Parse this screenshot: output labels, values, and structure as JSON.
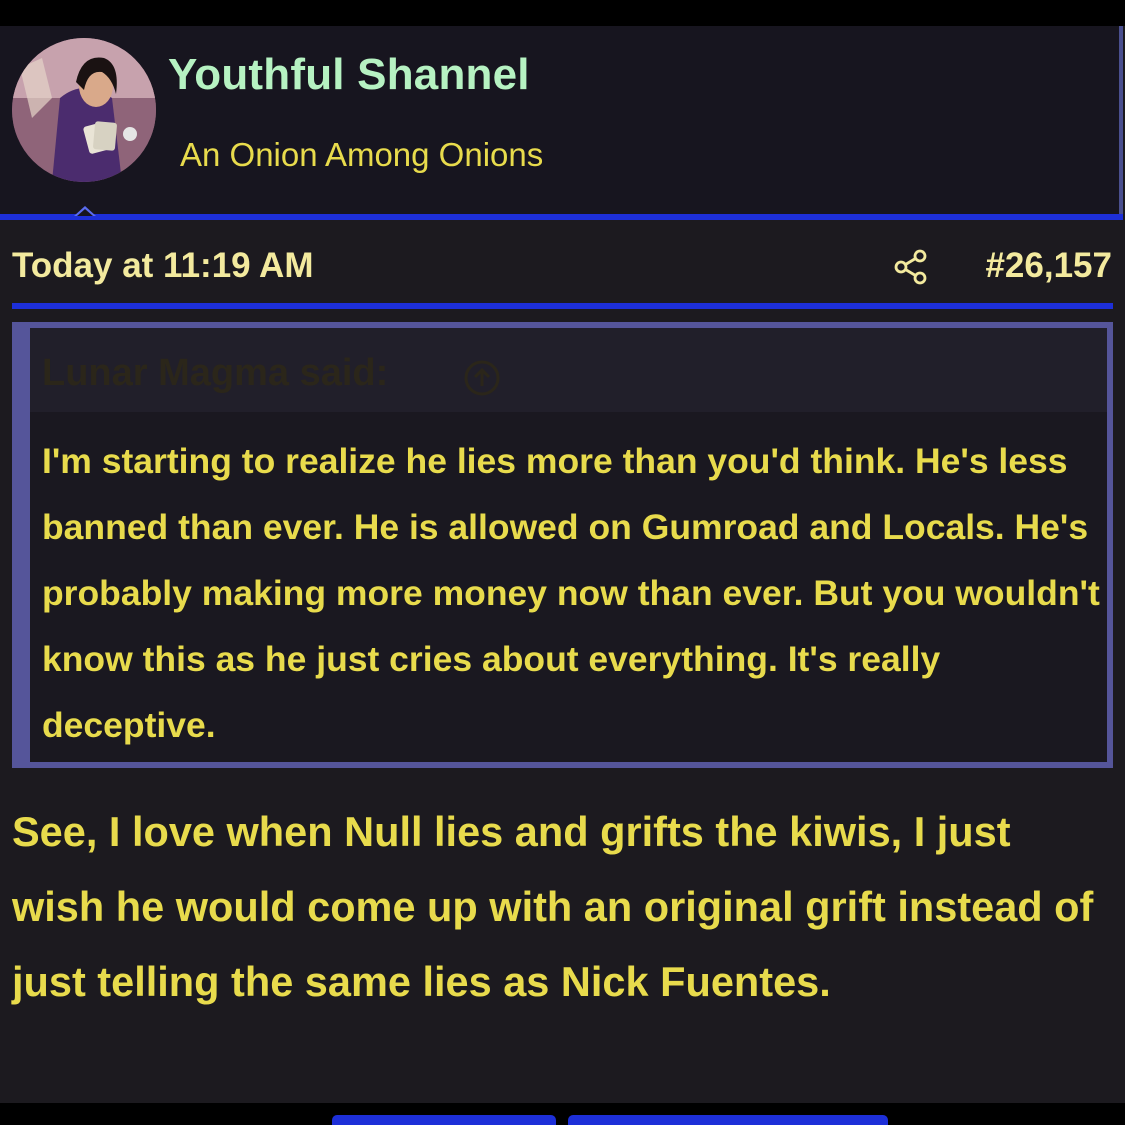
{
  "user": {
    "name": "Youthful Shannel",
    "title": "An Onion Among Onions"
  },
  "post": {
    "date": "Today at 11:19 AM",
    "number": "#26,157",
    "body": "See, I love when Null lies and grifts the kiwis, I just wish he would come up with an original grift instead of just telling the same lies as Nick Fuentes."
  },
  "quote": {
    "author": "Lunar Magma said:",
    "body": "I'm starting to realize he lies more than you'd think. He's less banned than ever. He is allowed on Gumroad and Locals. He's probably making more money now than ever. But you wouldn't know this as he just cries about everything. It's really deceptive."
  },
  "icons": {
    "share": "share-icon",
    "quote_jump": "arrow-up-circle-icon"
  },
  "colors": {
    "background": "#1c1a1f",
    "username": "#b6f2c2",
    "text": "#e8db4c",
    "accent_blue": "#1d2fd8",
    "quote_border": "#55559a"
  }
}
